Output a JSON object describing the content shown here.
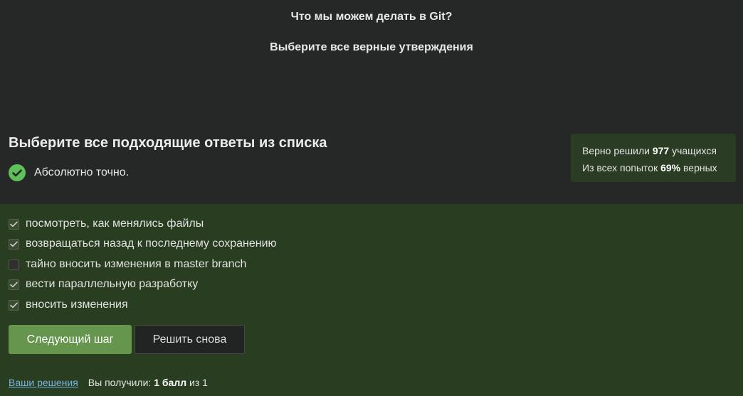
{
  "question": {
    "title": "Что мы можем делать в Git?",
    "subtitle": "Выберите все верные утверждения"
  },
  "task": {
    "heading": "Выберите все подходящие ответы из списка",
    "feedback": "Абсолютно точно.",
    "feedback_icon": "check-circle-icon",
    "feedback_color": "#5fbf5b"
  },
  "stats": {
    "solved_prefix": "Верно решили ",
    "solved_count": "977",
    "solved_suffix": " учащихся",
    "attempts_prefix": "Из всех попыток ",
    "attempts_percent": "69%",
    "attempts_suffix": " верных"
  },
  "options": [
    {
      "label": "посмотреть, как менялись файлы",
      "checked": true
    },
    {
      "label": "возвращаться назад к последнему сохранению",
      "checked": true
    },
    {
      "label": "тайно вносить изменения в master branch",
      "checked": false
    },
    {
      "label": "вести параллельную разработку",
      "checked": true
    },
    {
      "label": "вносить изменения",
      "checked": true
    }
  ],
  "buttons": {
    "next": "Следующий шаг",
    "retry": "Решить снова"
  },
  "footer": {
    "solutions_link": "Ваши решения",
    "score_prefix": "Вы получили: ",
    "score_value": "1 балл",
    "score_suffix": " из 1"
  },
  "colors": {
    "accent": "#66964e",
    "answers_bg": "#293d20",
    "page_bg": "#262727",
    "link": "#78b4e3"
  }
}
